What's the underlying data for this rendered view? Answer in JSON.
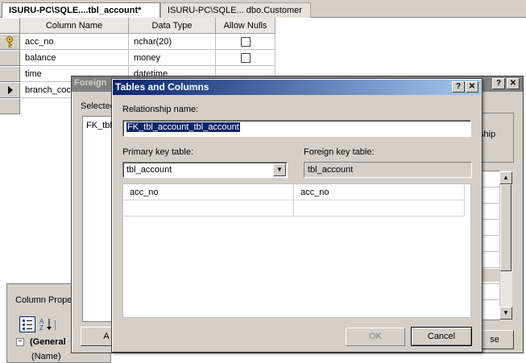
{
  "tabs": [
    {
      "label": "ISURU-PC\\SQLE....tbl_account*"
    },
    {
      "label": "ISURU-PC\\SQLE... dbo.Customer"
    }
  ],
  "grid": {
    "headers": [
      "Column Name",
      "Data Type",
      "Allow Nulls"
    ],
    "rows": [
      {
        "name": "acc_no",
        "type": "nchar(20)"
      },
      {
        "name": "balance",
        "type": "money"
      },
      {
        "name": "time",
        "type": "datetime"
      },
      {
        "name": "branch_coc",
        "type": ""
      }
    ]
  },
  "props": {
    "title": "Column Proper",
    "section": "(General",
    "item": "(Name)",
    "sort_alpha_label": "A",
    "sort_z_label": "Z"
  },
  "fk_dialog": {
    "title": "Foreign",
    "selected_label": "Selected",
    "list_item": "FK_tbl",
    "relationship_fragment": "ship",
    "add_label": "A",
    "close_label": "se"
  },
  "dialog": {
    "title": "Tables and Columns",
    "help_label": "?",
    "close_glyph": "✕",
    "relationship_label": "Relationship name:",
    "relationship_value": "FK_tbl_account_tbl_account",
    "pk_table_label": "Primary key table:",
    "pk_table_value": "tbl_account",
    "fk_table_label": "Foreign key table:",
    "fk_table_value": "tbl_account",
    "columns": [
      {
        "pk": "acc_no",
        "fk": "acc_no"
      },
      {
        "pk": "",
        "fk": ""
      }
    ],
    "ok_label": "OK",
    "cancel_label": "Cancel"
  }
}
